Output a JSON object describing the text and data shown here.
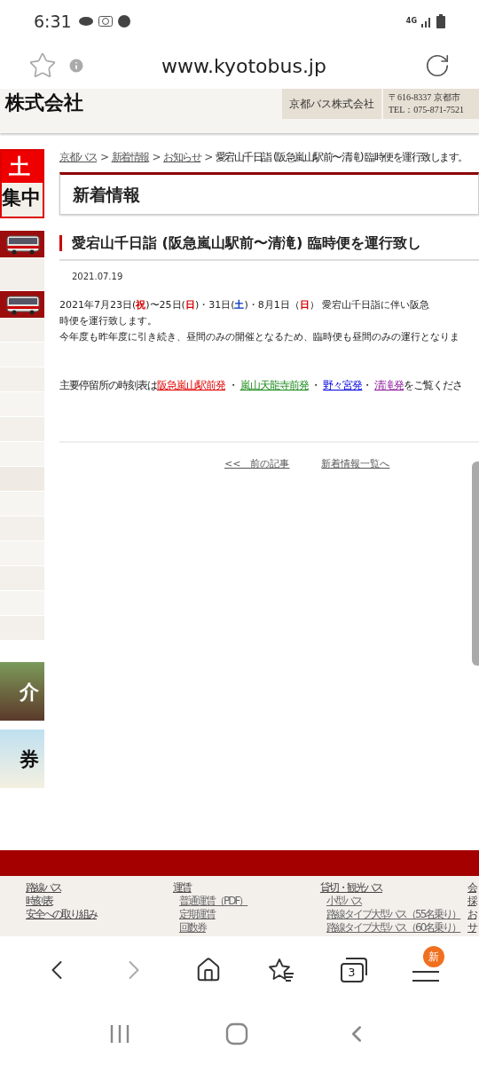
{
  "status_bar": {
    "time": "6:31",
    "network": "4G"
  },
  "browser": {
    "url": "www.kyotobus.jp",
    "back_disabled": false,
    "forward_disabled": true,
    "tab_count": "3",
    "menu_badge": "新"
  },
  "header": {
    "logo": "株式会社",
    "company": "京都バス株式会社",
    "address": "〒616-8337 京都市",
    "tel": "TEL：075-871-7521"
  },
  "sidebar": {
    "banner_top": "土",
    "banner_bottom": "集中",
    "tiles": [
      "介",
      "券"
    ]
  },
  "breadcrumb": {
    "separator": ">",
    "links": [
      "京都バス",
      "新着情報",
      "お知らせ"
    ],
    "current": "愛宕山千日詣 (阪急嵐山駅前〜清滝) 臨時便を運行致します。"
  },
  "section_title": "新着情報",
  "article": {
    "title": "愛宕山千日詣 (阪急嵐山駅前〜清滝) 臨時便を運行致し",
    "date": "2021.07.19",
    "lead": [
      {
        "text": "2021年7月23日("
      },
      {
        "text": "祝",
        "color": "#d40000"
      },
      {
        "text": ")〜25日("
      },
      {
        "text": "日",
        "color": "#d40000"
      },
      {
        "text": ")・31日("
      },
      {
        "text": "土",
        "color": "#0033bb"
      },
      {
        "text": ")・8月1日（"
      },
      {
        "text": "日",
        "color": "#d40000"
      },
      {
        "text": "）"
      }
    ],
    "lead_tail": "愛宕山千日詣に伴い阪急",
    "lines": [
      "時便を運行致します。",
      "今年度も昨年度に引き続き、昼間のみの開催となるため、臨時便も昼間のみの運行となりま"
    ],
    "timetable": [
      {
        "kind": "text",
        "text": "主要停留所の時刻表は"
      },
      {
        "kind": "link",
        "text": "阪急嵐山駅前発",
        "color": "#e00000"
      },
      {
        "kind": "text",
        "text": " ・ "
      },
      {
        "kind": "link",
        "text": "嵐山天龍寺前発",
        "color": "#1a8a1a"
      },
      {
        "kind": "text",
        "text": " ・ "
      },
      {
        "kind": "link",
        "text": "野々宮発",
        "color": "#0000dd"
      },
      {
        "kind": "text",
        "text": "・ "
      },
      {
        "kind": "link",
        "text": "清滝発",
        "color": "#8a1a9a"
      },
      {
        "kind": "text",
        "text": "をご覧くださ"
      }
    ]
  },
  "pager": [
    "<<　前の記事",
    "新着情報一覧へ"
  ],
  "footer": {
    "columns": [
      [
        {
          "kind": "main",
          "text": "路線バス"
        },
        {
          "kind": "main",
          "text": "時刻表"
        },
        {
          "kind": "main",
          "text": "安全への取り組み"
        }
      ],
      [
        {
          "kind": "main",
          "text": "運賃"
        },
        {
          "kind": "sub",
          "text": "普通運賃（PDF）"
        },
        {
          "kind": "sub",
          "text": "定期運賃"
        },
        {
          "kind": "sub",
          "text": "回数券"
        }
      ],
      [
        {
          "kind": "main",
          "text": "貸切・観光バス"
        },
        {
          "kind": "sub",
          "text": "小型バス"
        },
        {
          "kind": "sub",
          "text": "路線タイプ大型バス（55名乗り）"
        },
        {
          "kind": "sub",
          "text": "路線タイプ大型バス（60名乗り）"
        }
      ],
      [
        {
          "kind": "main",
          "text": "会"
        },
        {
          "kind": "main",
          "text": "採"
        },
        {
          "kind": "main",
          "text": "お"
        },
        {
          "kind": "main",
          "text": "サ"
        }
      ]
    ]
  }
}
